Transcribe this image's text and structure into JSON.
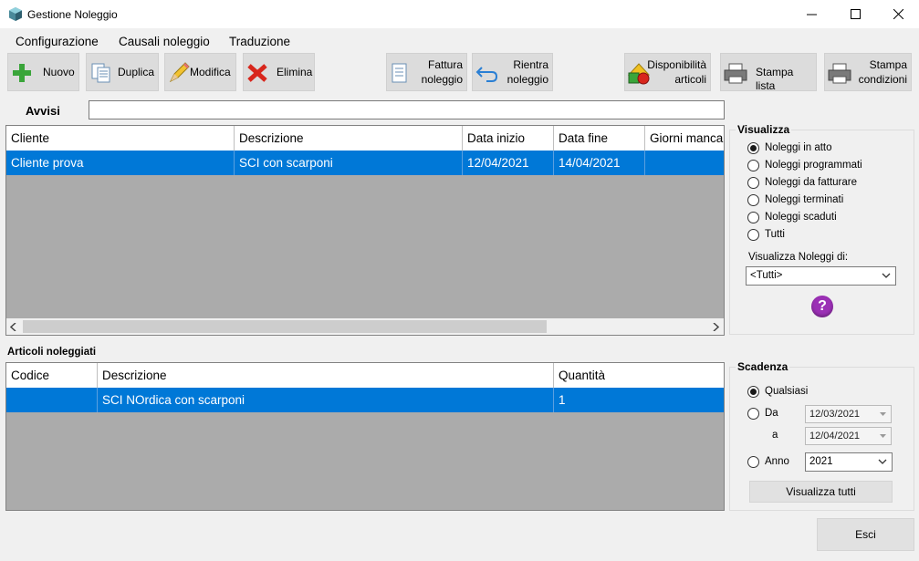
{
  "window": {
    "title": "Gestione Noleggio"
  },
  "menu": [
    "Configurazione",
    "Causali noleggio",
    "Traduzione"
  ],
  "toolbar": {
    "nuovo": "Nuovo",
    "duplica": "Duplica",
    "modifica": "Modifica",
    "elimina": "Elimina",
    "fattura": [
      "Fattura",
      "noleggio"
    ],
    "rientra": [
      "Rientra",
      "noleggio"
    ],
    "disponibilita": [
      "Disponibilità",
      "articoli"
    ],
    "stampa_lista": "Stampa lista",
    "stampa_condizioni": [
      "Stampa",
      "condizioni"
    ]
  },
  "avvisi": {
    "label": "Avvisi",
    "value": ""
  },
  "noleggi_grid": {
    "columns": [
      "Cliente",
      "Descrizione",
      "Data inizio",
      "Data fine",
      "Giorni mancanti"
    ],
    "rows": [
      [
        "Cliente prova",
        "SCI con scarponi",
        "12/04/2021",
        "14/04/2021",
        ""
      ]
    ]
  },
  "articoli": {
    "title": "Articoli noleggiati",
    "columns": [
      "Codice",
      "Descrizione",
      "Quantità"
    ],
    "rows": [
      [
        "",
        "SCI NOrdica con scarponi",
        "1"
      ]
    ]
  },
  "visualizza": {
    "title": "Visualizza",
    "options": [
      "Noleggi in atto",
      "Noleggi programmati",
      "Noleggi da fatturare",
      "Noleggi terminati",
      "Noleggi scaduti",
      "Tutti"
    ],
    "selected": 0,
    "filter_label": "Visualizza Noleggi di:",
    "filter_value": "<Tutti>"
  },
  "scadenza": {
    "title": "Scadenza",
    "qualsiasi": "Qualsiasi",
    "da": "Da",
    "a": "a",
    "anno": "Anno",
    "da_value": "12/03/2021",
    "a_value": "12/04/2021",
    "anno_value": "2021",
    "button": "Visualizza tutti"
  },
  "esci": "Esci",
  "colors": {
    "selection": "#0078d7",
    "grid_bg": "#ababab",
    "help": "#9b30b5"
  }
}
